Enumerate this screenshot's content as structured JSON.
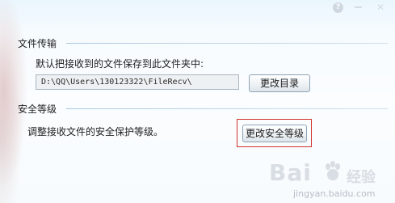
{
  "window": {
    "controls": {
      "help": "?",
      "close": "✕"
    }
  },
  "file_transfer": {
    "section_title": "文件传输",
    "description": "默认把接收到的文件保存到此文件夹中:",
    "path_value": "D:\\QQ\\Users\\130123322\\FileRecv\\",
    "change_dir_button": "更改目录"
  },
  "security_level": {
    "section_title": "安全等级",
    "description": "调整接收文件的安全保护等级。",
    "change_level_button": "更改安全等级",
    "highlight_color": "#d1322e"
  },
  "watermark": {
    "brand": "Bai",
    "brand_suffix": "经验",
    "url": "jingyan.baidu.com"
  }
}
